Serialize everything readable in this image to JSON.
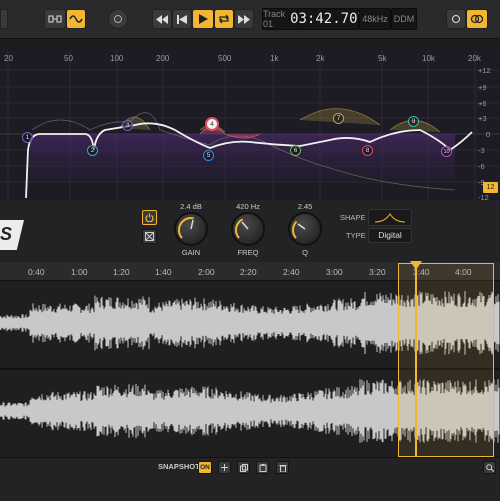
{
  "transport": {
    "track_label": "Track 01",
    "time": "03:42.707",
    "sample_rate": "48kHz",
    "mode": "DDM"
  },
  "eq": {
    "freq_labels": [
      "20",
      "50",
      "100",
      "200",
      "500",
      "1k",
      "2k",
      "5k",
      "10k",
      "20k"
    ],
    "db_labels": [
      "+12",
      "+9",
      "+6",
      "+3",
      "0",
      "-3",
      "-6",
      "-9",
      "-12"
    ],
    "nodes": [
      {
        "label": "1",
        "color": "#7a5fc8"
      },
      {
        "label": "2",
        "color": "#2fb0b8"
      },
      {
        "label": "3",
        "color": "#6a6ad0"
      },
      {
        "label": "4",
        "color": "#d8506a"
      },
      {
        "label": "5",
        "color": "#3a8ae0"
      },
      {
        "label": "6",
        "color": "#6ac050"
      },
      {
        "label": "7",
        "color": "#c9a23a"
      },
      {
        "label": "8",
        "color": "#d8506a"
      },
      {
        "label": "9",
        "color": "#3ac0a0"
      },
      {
        "label": "10",
        "color": "#c050c0"
      }
    ],
    "corner_value": "12"
  },
  "band_panel": {
    "gain_value": "2.4 dB",
    "gain_label": "GAIN",
    "freq_value": "420 Hz",
    "freq_label": "FREQ",
    "q_value": "2.45",
    "q_label": "Q",
    "shape_label": "SHAPE",
    "type_label": "TYPE",
    "type_value": "Digital",
    "logo_text": "S"
  },
  "timeline": {
    "ticks": [
      "0:40",
      "1:00",
      "1:20",
      "1:40",
      "2:00",
      "2:20",
      "2:40",
      "3:00",
      "3:20",
      "3:40",
      "4:00"
    ],
    "playhead_fraction_of_duration": 0.93
  },
  "bottom": {
    "snapshot_label": "SNAPSHOT",
    "snapshot_state": "ON"
  },
  "colors": {
    "accent": "#f2b632"
  }
}
